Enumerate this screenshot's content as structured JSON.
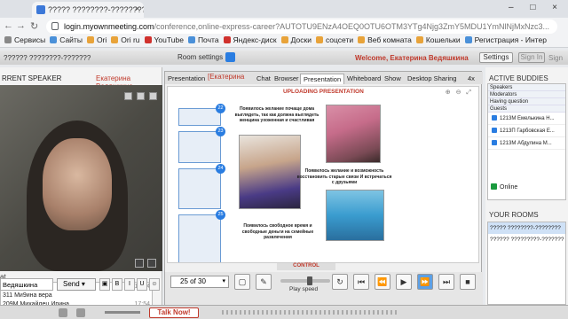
{
  "browser": {
    "tab_title": "????? ????????-?????????",
    "url_host": "login.myownmeeting.com",
    "url_path": "/conference,online-express-career?AUTOTU9ENzA4OEQ0OTU6OTM3YTg4Njg3ZmY5MDU1YmNlNjMxNzc3...",
    "bookmarks": [
      "Сервисы",
      "Сайты",
      "Ori",
      "Ori ru",
      "YouTube",
      "Почта",
      "Яндекс-диск",
      "Доски",
      "соцсети",
      "Веб комната",
      "Кошельки",
      "Регистрация - Интер"
    ]
  },
  "app_toolbar": {
    "title": "?????? ????????-???????",
    "room_settings": "Room settings",
    "welcome": "Welcome, Екатерина Ведяшкина",
    "settings": "Settings",
    "sign_in": "Sign In",
    "sign_up": "Sign"
  },
  "speaker": {
    "title": "RRENT SPEAKER",
    "name": "Екатерина Ведяшкина"
  },
  "chat": {
    "label": "at",
    "messages": [
      {
        "text": "3 ?????????",
        "time": "17:34"
      },
      {
        "text": "311 Ми9ина вера",
        "time": ""
      },
      {
        "text": "209М Михайлец Ирина",
        "time": "17:54"
      },
      {
        "text": "разит, супер!!!!!",
        "time": "17:54"
      }
    ],
    "input_value": "Ведяшкина",
    "send": "Send"
  },
  "presentation": {
    "tabs": [
      "Presentation",
      "Chat",
      "Browser",
      "Presentation",
      "Whiteboard",
      "Show",
      "Desktop Sharing",
      "4x"
    ],
    "name": "[Екатерина",
    "uploading_title": "UPLOADING PRESENTATION",
    "control_label": "CONTROL",
    "page_select": "25 of 30",
    "play_speed": "Play speed",
    "play_speed_fraction": 0.6,
    "thumb_numbers": [
      "22",
      "23",
      "24",
      "25"
    ],
    "slide_text_1": "Появилось желание почаще дома выглядеть, так как должна выглядеть женщина ухоженная и счастливая",
    "slide_text_2": "Появилось желание и возможность восстановить старые связи И встречаться с друзьями",
    "slide_text_3": "Появилось свободное время и свободные деньги на семейные развлечения"
  },
  "right_panel": {
    "active_buddies": "ACTIVE BUDDIES",
    "groups": [
      "Speakers",
      "Moderators",
      "Having question",
      "Guests"
    ],
    "buddies": [
      "1213М Емелькина Н...",
      "1213П Гарбовская Е...",
      "1213М Абдулина М..."
    ],
    "online": "Online",
    "your_rooms": "YOUR ROOMS",
    "rooms": [
      "????? ????????-????????",
      "?????? ?????????-??????? 300"
    ]
  },
  "bottom": {
    "talk_now": "Talk Now!"
  },
  "colors": {
    "accent_red": "#c0392b",
    "accent_blue": "#2a7de1",
    "online_green": "#1a9a3e"
  }
}
